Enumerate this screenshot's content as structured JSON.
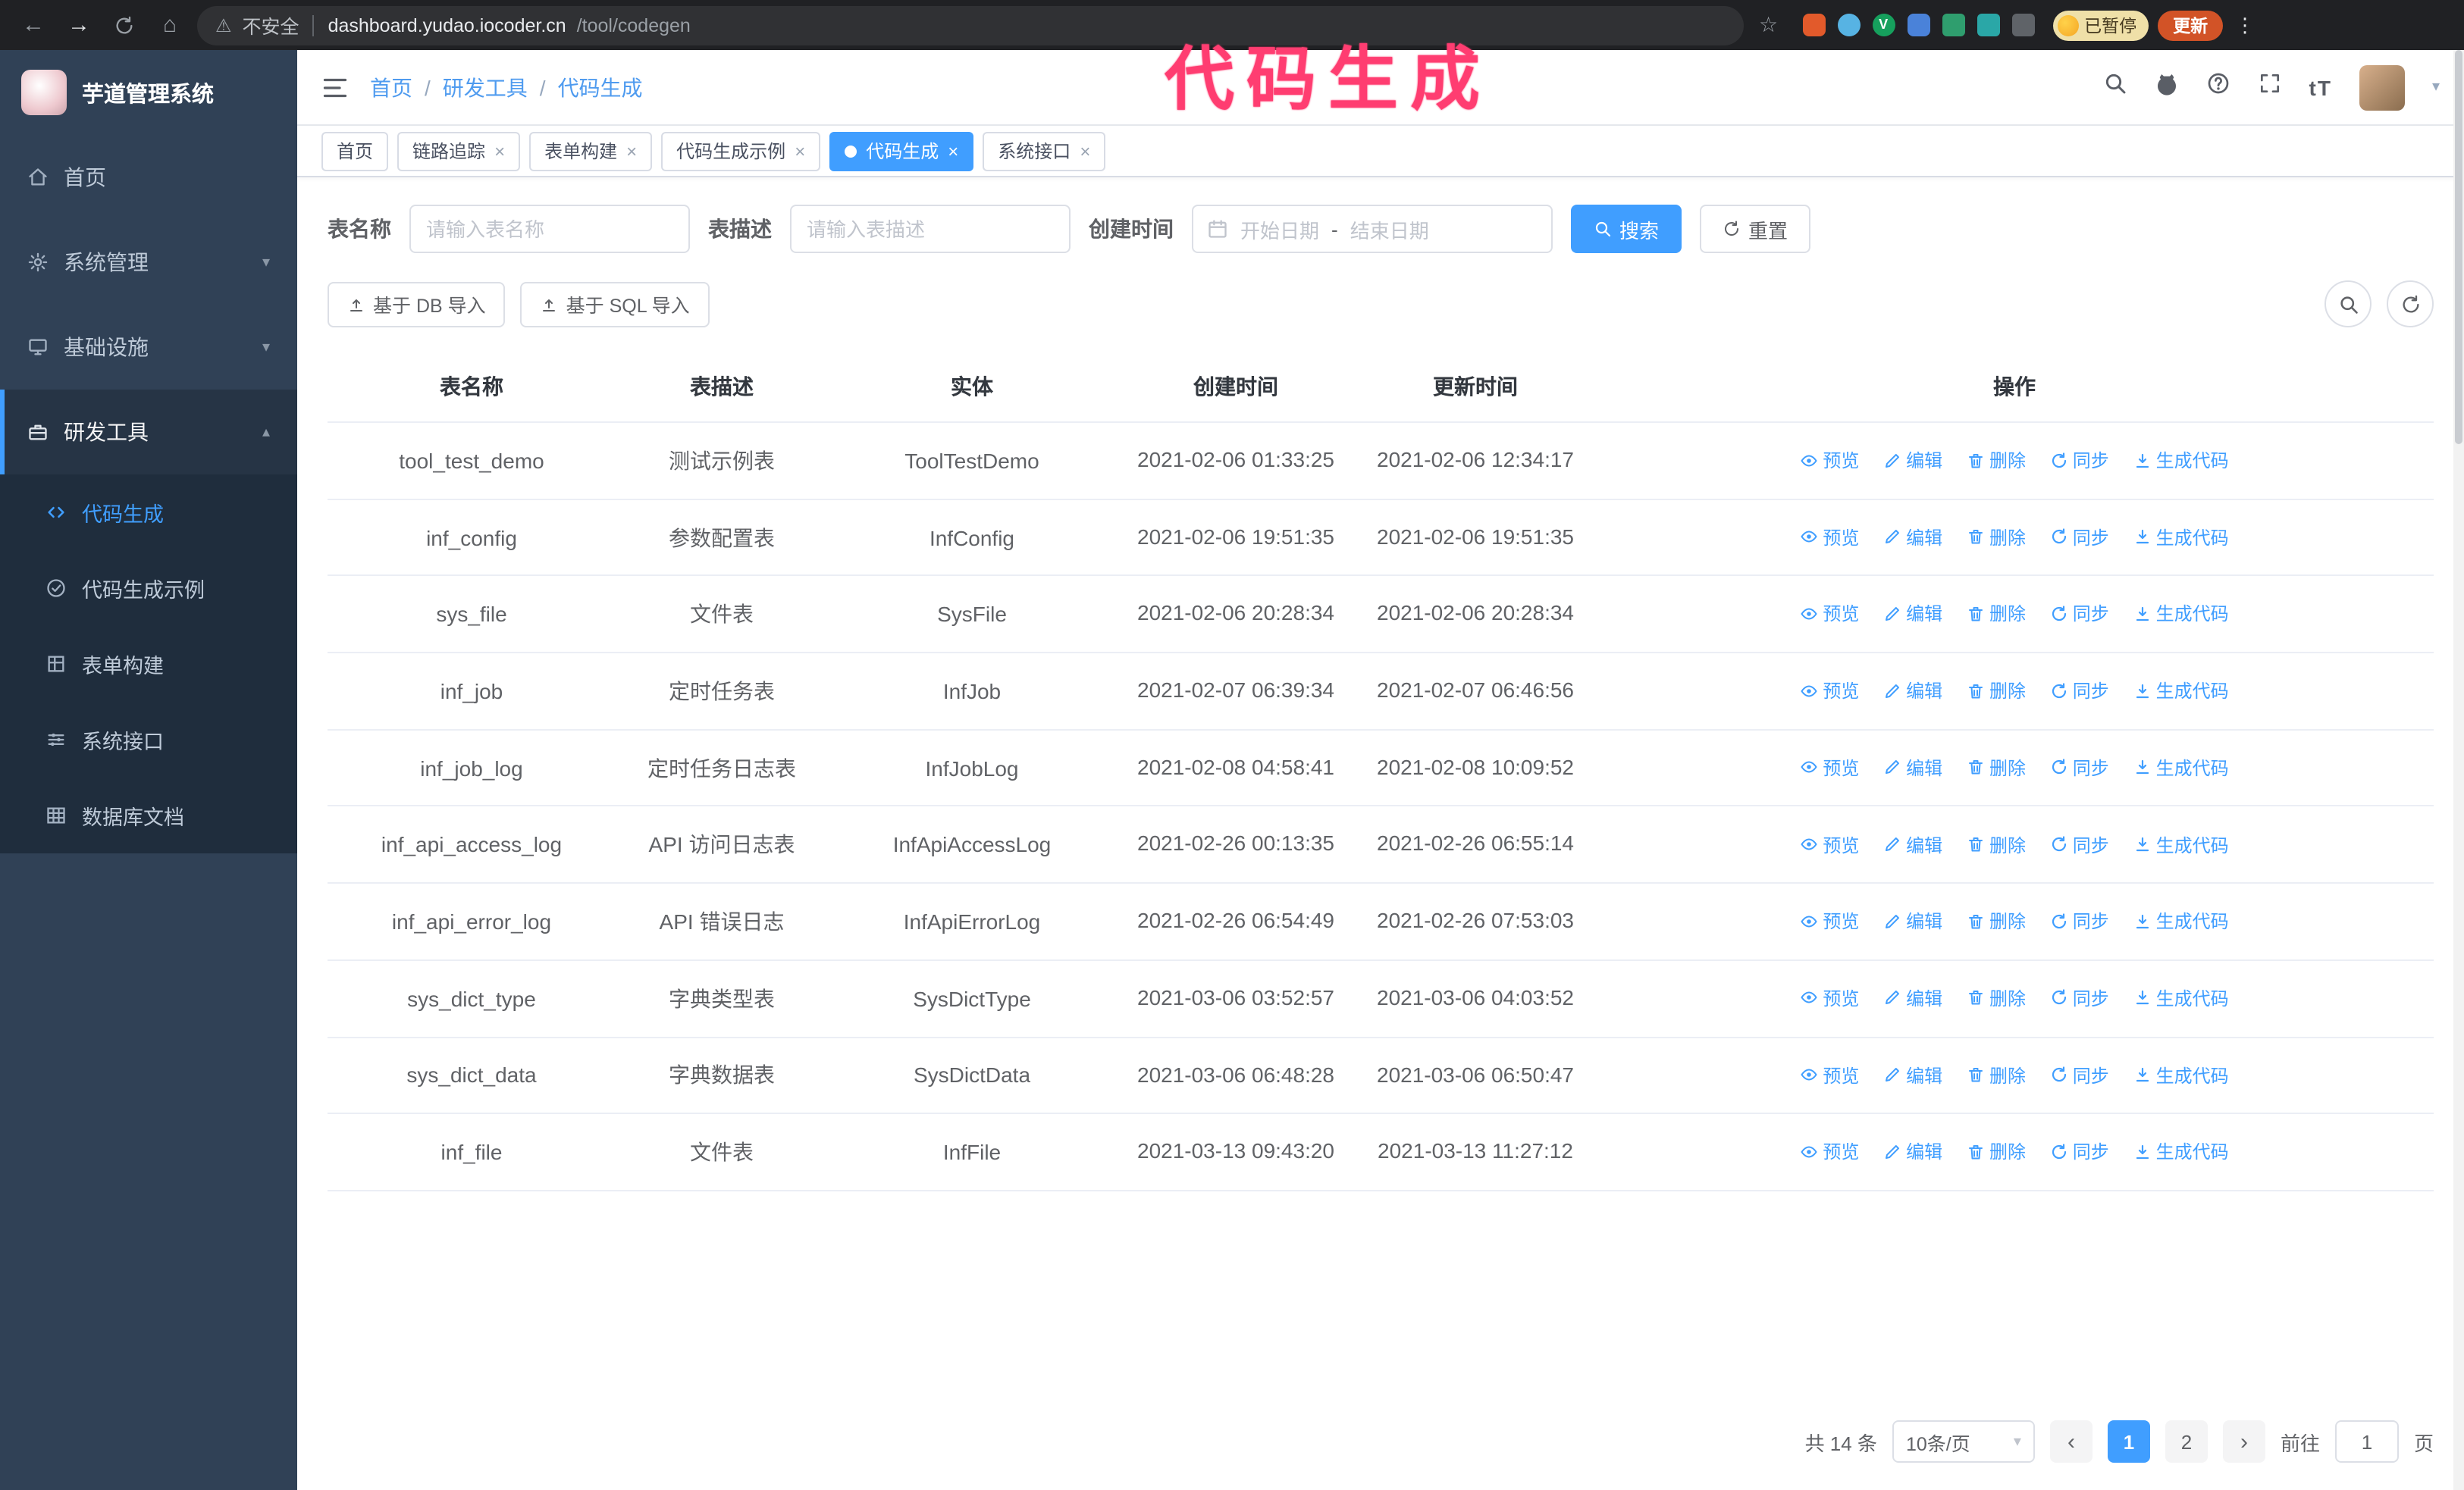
{
  "annotation": {
    "text": "代码生成",
    "color": "#ff3d71"
  },
  "icons": {
    "back": "←",
    "forward": "→",
    "home": "⌂",
    "warning": "⚠",
    "star": "☆",
    "kebab": "⋮",
    "slash": "/",
    "close": "×",
    "caret_down": "▾",
    "caret_up": "▴",
    "chevron_left": "‹",
    "chevron_right": "›",
    "font_size": "tT"
  },
  "browser": {
    "security_label": "不安全",
    "url_domain": "dashboard.yudao.iocoder.cn",
    "url_path": "/tool/codegen",
    "paused_badge": "已暂停",
    "update_label": "更新"
  },
  "sidebar": {
    "logo_title": "芋道管理系统",
    "menu": [
      {
        "label": "首页"
      },
      {
        "label": "系统管理"
      },
      {
        "label": "基础设施"
      },
      {
        "label": "研发工具"
      }
    ],
    "submenu": [
      {
        "label": "代码生成"
      },
      {
        "label": "代码生成示例"
      },
      {
        "label": "表单构建"
      },
      {
        "label": "系统接口"
      },
      {
        "label": "数据库文档"
      }
    ]
  },
  "header": {
    "breadcrumb": {
      "home": "首页",
      "group": "研发工具",
      "current": "代码生成"
    }
  },
  "tabs": {
    "items": [
      {
        "label": "首页"
      },
      {
        "label": "链路追踪"
      },
      {
        "label": "表单构建"
      },
      {
        "label": "代码生成示例"
      },
      {
        "label": "代码生成"
      },
      {
        "label": "系统接口"
      }
    ]
  },
  "filters": {
    "name_label": "表名称",
    "name_placeholder": "请输入表名称",
    "desc_label": "表描述",
    "desc_placeholder": "请输入表描述",
    "time_label": "创建时间",
    "start_placeholder": "开始日期",
    "range_separator": "-",
    "end_placeholder": "结束日期",
    "search_label": "搜索",
    "reset_label": "重置"
  },
  "toolbar": {
    "import_db": "基于 DB 导入",
    "import_sql": "基于 SQL 导入"
  },
  "table": {
    "columns": {
      "name": "表名称",
      "desc": "表描述",
      "entity": "实体",
      "created": "创建时间",
      "updated": "更新时间",
      "ops": "操作"
    },
    "actions": {
      "preview": "预览",
      "edit": "编辑",
      "delete": "删除",
      "sync": "同步",
      "generate": "生成代码"
    },
    "rows": [
      {
        "name": "tool_test_demo",
        "desc": "测试示例表",
        "entity": "ToolTestDemo",
        "created": "2021-02-06 01:33:25",
        "updated": "2021-02-06 12:34:17"
      },
      {
        "name": "inf_config",
        "desc": "参数配置表",
        "entity": "InfConfig",
        "created": "2021-02-06 19:51:35",
        "updated": "2021-02-06 19:51:35"
      },
      {
        "name": "sys_file",
        "desc": "文件表",
        "entity": "SysFile",
        "created": "2021-02-06 20:28:34",
        "updated": "2021-02-06 20:28:34"
      },
      {
        "name": "inf_job",
        "desc": "定时任务表",
        "entity": "InfJob",
        "created": "2021-02-07 06:39:34",
        "updated": "2021-02-07 06:46:56"
      },
      {
        "name": "inf_job_log",
        "desc": "定时任务日志表",
        "entity": "InfJobLog",
        "created": "2021-02-08 04:58:41",
        "updated": "2021-02-08 10:09:52"
      },
      {
        "name": "inf_api_access_log",
        "desc": "API 访问日志表",
        "entity": "InfApiAccessLog",
        "created": "2021-02-26 00:13:35",
        "updated": "2021-02-26 06:55:14"
      },
      {
        "name": "inf_api_error_log",
        "desc": "API 错误日志",
        "entity": "InfApiErrorLog",
        "created": "2021-02-26 06:54:49",
        "updated": "2021-02-26 07:53:03"
      },
      {
        "name": "sys_dict_type",
        "desc": "字典类型表",
        "entity": "SysDictType",
        "created": "2021-03-06 03:52:57",
        "updated": "2021-03-06 04:03:52"
      },
      {
        "name": "sys_dict_data",
        "desc": "字典数据表",
        "entity": "SysDictData",
        "created": "2021-03-06 06:48:28",
        "updated": "2021-03-06 06:50:47"
      },
      {
        "name": "inf_file",
        "desc": "文件表",
        "entity": "InfFile",
        "created": "2021-03-13 09:43:20",
        "updated": "2021-03-13 11:27:12"
      }
    ]
  },
  "pagination": {
    "total": "共 14 条",
    "page_size": "10条/页",
    "page1": "1",
    "page2": "2",
    "goto_label": "前往",
    "goto_value": "1",
    "goto_unit": "页"
  }
}
